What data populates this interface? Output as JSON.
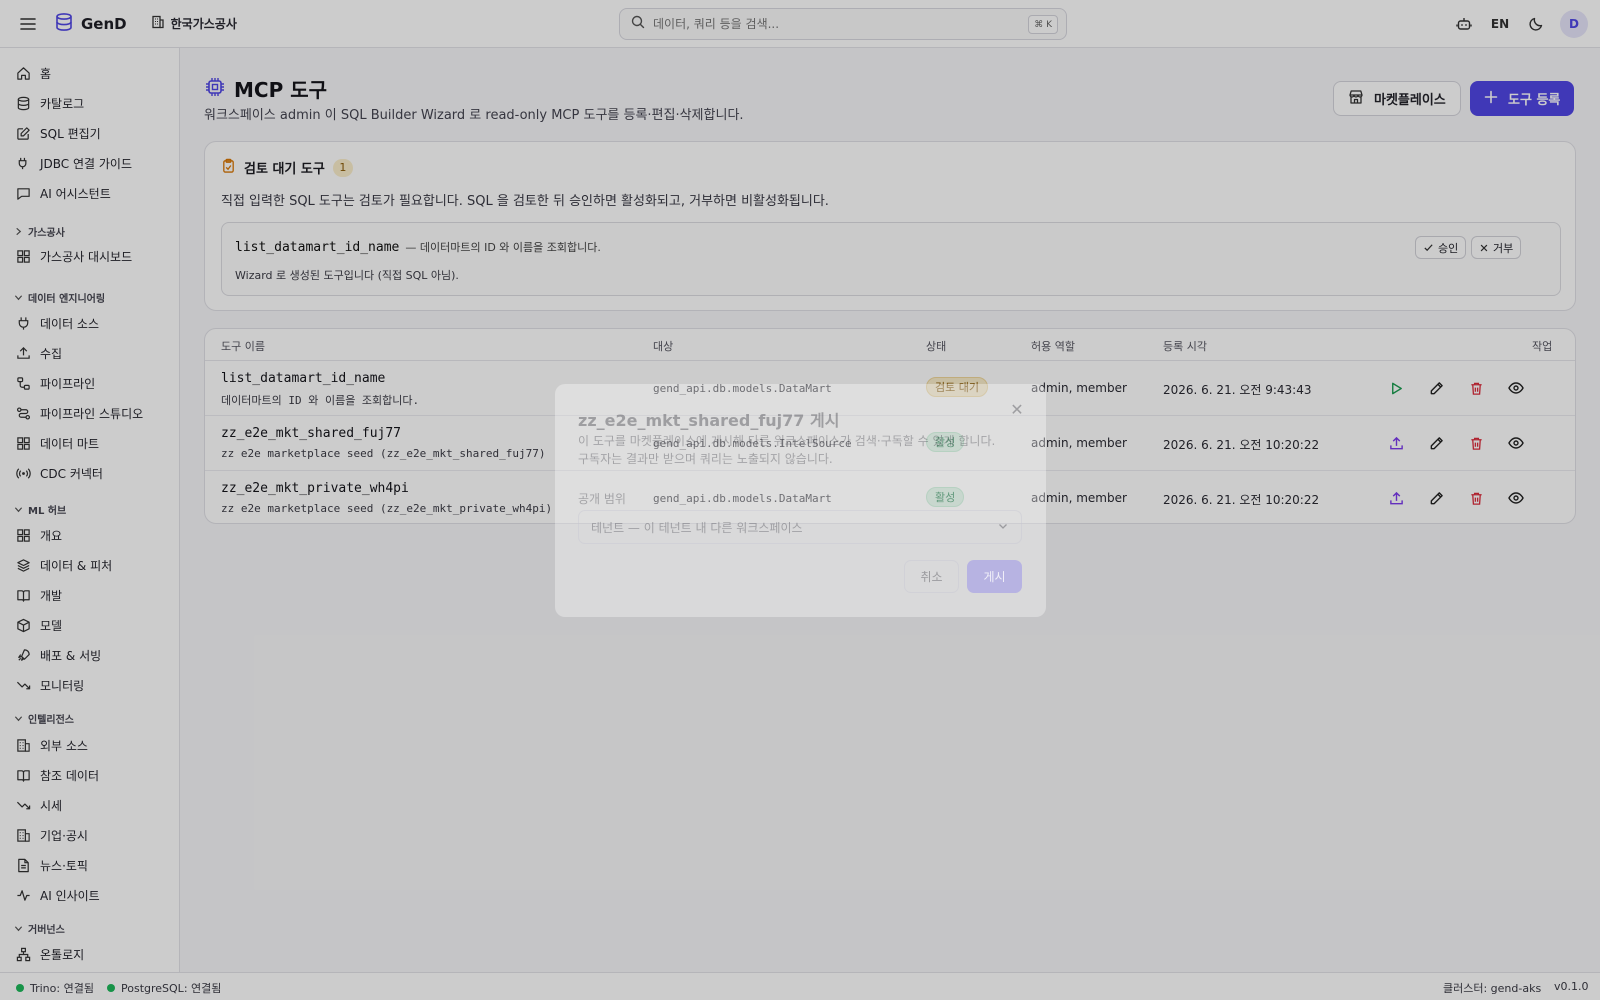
{
  "app": {
    "name": "GenD",
    "tenant": "한국가스공사",
    "search_placeholder": "데이터, 쿼리 등을 검색...",
    "search_shortcut": "⌘ K",
    "lang": "EN",
    "avatar_initial": "D"
  },
  "sidebar": {
    "top_items": [
      {
        "label": "홈",
        "icon": "home-icon"
      },
      {
        "label": "카탈로그",
        "icon": "database-icon"
      },
      {
        "label": "SQL 편집기",
        "icon": "edit-icon"
      },
      {
        "label": "JDBC 연결 가이드",
        "icon": "plug-icon"
      },
      {
        "label": "AI 어시스턴트",
        "icon": "chat-icon"
      }
    ],
    "groups": [
      {
        "label": "가스공사",
        "collapsed": true,
        "items": [
          {
            "label": "가스공사 대시보드",
            "icon": "grid-icon"
          }
        ]
      },
      {
        "label": "데이터 엔지니어링",
        "collapsed": false,
        "items": [
          {
            "label": "데이터 소스",
            "icon": "plug-icon"
          },
          {
            "label": "수집",
            "icon": "upload-icon"
          },
          {
            "label": "파이프라인",
            "icon": "pipeline-icon"
          },
          {
            "label": "파이프라인 스튜디오",
            "icon": "workflow-icon"
          },
          {
            "label": "데이터 마트",
            "icon": "grid-icon"
          },
          {
            "label": "CDC 커넥터",
            "icon": "radio-icon"
          }
        ]
      },
      {
        "label": "ML 허브",
        "collapsed": false,
        "items": [
          {
            "label": "개요",
            "icon": "grid-icon"
          },
          {
            "label": "데이터 & 피처",
            "icon": "layers-icon"
          },
          {
            "label": "개발",
            "icon": "book-icon"
          },
          {
            "label": "모델",
            "icon": "box-icon"
          },
          {
            "label": "배포 & 서빙",
            "icon": "rocket-icon"
          },
          {
            "label": "모니터링",
            "icon": "trend-icon"
          }
        ]
      },
      {
        "label": "인텔리전스",
        "collapsed": false,
        "items": [
          {
            "label": "외부 소스",
            "icon": "building-icon"
          },
          {
            "label": "참조 데이터",
            "icon": "book-icon"
          },
          {
            "label": "시세",
            "icon": "trend-icon"
          },
          {
            "label": "기업·공시",
            "icon": "building-icon"
          },
          {
            "label": "뉴스·토픽",
            "icon": "document-icon"
          },
          {
            "label": "AI 인사이트",
            "icon": "activity-icon"
          }
        ]
      },
      {
        "label": "거버넌스",
        "collapsed": false,
        "items": [
          {
            "label": "온톨로지",
            "icon": "network-icon"
          }
        ]
      }
    ]
  },
  "page": {
    "title": "MCP 도구",
    "subtitle": "워크스페이스 admin 이 SQL Builder Wizard 로 read-only MCP 도구를 등록·편집·삭제합니다.",
    "marketplace_button": "마켓플레이스",
    "register_button": "도구 등록"
  },
  "review": {
    "title": "검토 대기 도구",
    "count": "1",
    "description": "직접 입력한 SQL 도구는 검토가 필요합니다. SQL 을 검토한 뒤 승인하면 활성화되고, 거부하면 비활성화됩니다.",
    "item": {
      "name": "list_datamart_id_name",
      "desc": "— 데이터마트의 ID 와 이름을 조회합니다.",
      "note": "Wizard 로 생성된 도구입니다 (직접 SQL 아님).",
      "approve": "승인",
      "reject": "거부"
    }
  },
  "table": {
    "headers": {
      "name": "도구 이름",
      "target": "대상",
      "status": "상태",
      "roles": "허용 역할",
      "time": "등록 시각",
      "actions": "작업"
    },
    "rows": [
      {
        "name": "list_datamart_id_name",
        "desc": "데이터마트의 ID 와 이름을 조회합니다.",
        "target": "gend_api.db.models.DataMart",
        "status": "검토 대기",
        "status_kind": "pending",
        "roles": "admin, member",
        "time": "2026. 6. 21. 오전 9:43:43",
        "primary_action": "play-icon"
      },
      {
        "name": "zz_e2e_mkt_shared_fuj77",
        "desc": "zz e2e marketplace seed (zz_e2e_mkt_shared_fuj77)",
        "target": "gend_api.db.models.IntelSource",
        "status": "활성",
        "status_kind": "active",
        "roles": "admin, member",
        "time": "2026. 6. 21. 오전 10:20:22",
        "primary_action": "upload-icon"
      },
      {
        "name": "zz_e2e_mkt_private_wh4pi",
        "desc": "zz e2e marketplace seed (zz_e2e_mkt_private_wh4pi)",
        "target": "gend_api.db.models.DataMart",
        "status": "활성",
        "status_kind": "active",
        "roles": "admin, member",
        "time": "2026. 6. 21. 오전 10:20:22",
        "primary_action": "upload-icon"
      }
    ]
  },
  "modal": {
    "title": "zz_e2e_mkt_shared_fuj77 게시",
    "description_line1": "이 도구를 마켓플레이스에 게시해 다른 워크스페이스가 검색·구독할 수 있게 합니다.",
    "description_line2": "구독자는 결과만 받으며 쿼리는 노출되지 않습니다.",
    "scope_label": "공개 범위",
    "scope_value": "테넌트 — 이 테넌트 내 다른 워크스페이스",
    "cancel": "취소",
    "publish": "게시"
  },
  "statusbar": {
    "trino": "Trino: 연결됨",
    "postgres": "PostgreSQL: 연결됨",
    "cluster": "클러스터: gend-aks",
    "version": "v0.1.0"
  },
  "colors": {
    "accent": "#5046e5",
    "pending_bg": "#fbeecb",
    "active_bg": "#d6f3e2",
    "danger": "#dc2c3c",
    "success": "#1db85b"
  }
}
